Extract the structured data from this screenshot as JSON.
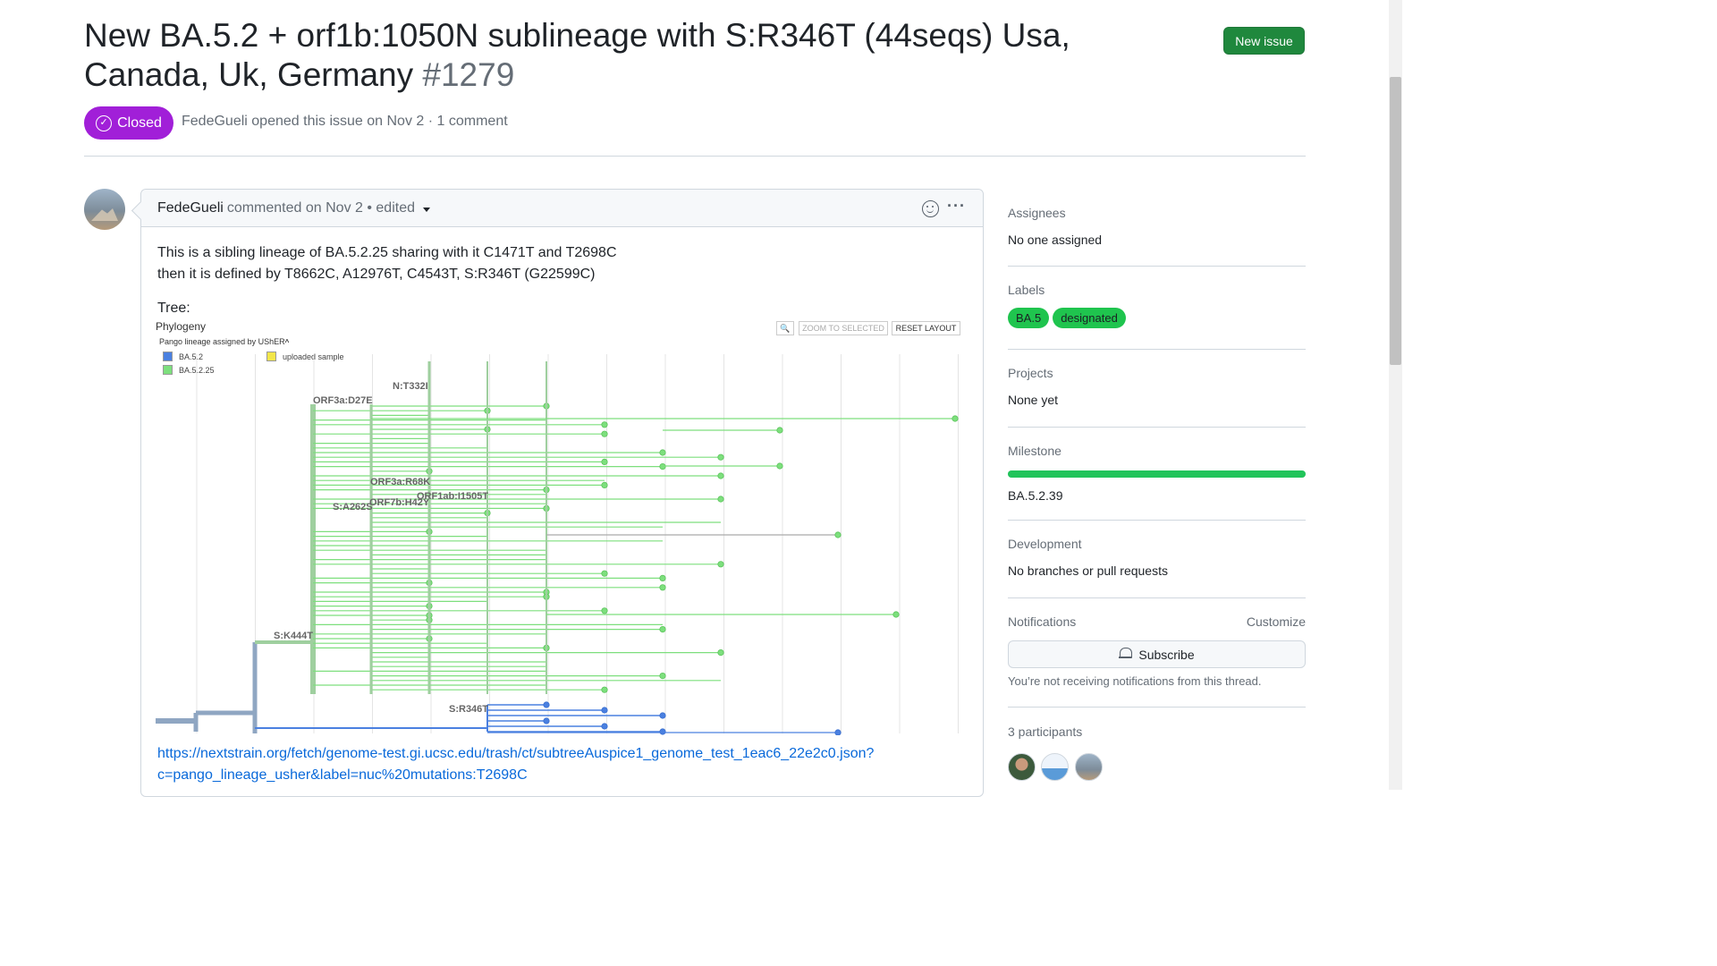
{
  "issue": {
    "title": "New BA.5.2 + orf1b:1050N sublineage with S:R346T (44seqs) Usa, Canada, Uk, Germany",
    "number": "#1279",
    "state": "Closed",
    "author": "FedeGueli",
    "meta": "opened this issue on Nov 2 · 1 comment",
    "new_issue_label": "New issue"
  },
  "comment": {
    "author": "FedeGueli",
    "meta": "commented on Nov 2 • edited",
    "line1": "This is a sibling lineage of BA.5.2.25 sharing with it C1471T and T2698C",
    "line2": "then it is defined by T8662C, A12976T, C4543T, S:R346T (G22599C)",
    "tree_label": "Tree:",
    "link_line1": "https://nextstrain.org/fetch/genome-test.gi.ucsc.edu/trash/ct/subtreeAuspice1_genome_test_1eac6_22e2c0.json?",
    "link_line2": "c=pango_lineage_usher&label=nuc%20mutations:T2698C"
  },
  "phylogeny": {
    "title": "Phylogeny",
    "subtitle": "Pango lineage assigned by UShER",
    "legend": [
      {
        "label": "BA.5.2",
        "color": "#4a80e0"
      },
      {
        "label": "BA.5.2.25",
        "color": "#7ddf7d"
      },
      {
        "label": "uploaded sample",
        "color": "#f2e64a"
      }
    ],
    "buttons": {
      "zoom_selected": "ZOOM TO SELECTED",
      "reset_layout": "RESET LAYOUT"
    },
    "mutation_labels": [
      "N:T332I",
      "ORF3a:D27E",
      "ORF3a:R68K",
      "ORF1ab:I1505T",
      "ORF7b:H42Y",
      "S:A262S",
      "S:K444T",
      "S:R346T"
    ]
  },
  "sidebar": {
    "assignees": {
      "head": "Assignees",
      "value": "No one assigned"
    },
    "labels": {
      "head": "Labels",
      "items": [
        "BA.5",
        "designated"
      ]
    },
    "projects": {
      "head": "Projects",
      "value": "None yet"
    },
    "milestone": {
      "head": "Milestone",
      "value": "BA.5.2.39",
      "progress": 1.0
    },
    "development": {
      "head": "Development",
      "value": "No branches or pull requests"
    },
    "notifications": {
      "head": "Notifications",
      "customize": "Customize",
      "subscribe": "Subscribe",
      "note": "You’re not receiving notifications from this thread."
    },
    "participants": {
      "head": "3 participants"
    }
  },
  "colors": {
    "closed": "#a11fd8",
    "green_button": "#1f883d",
    "label_green": "#1fc44e",
    "link": "#0969da"
  }
}
